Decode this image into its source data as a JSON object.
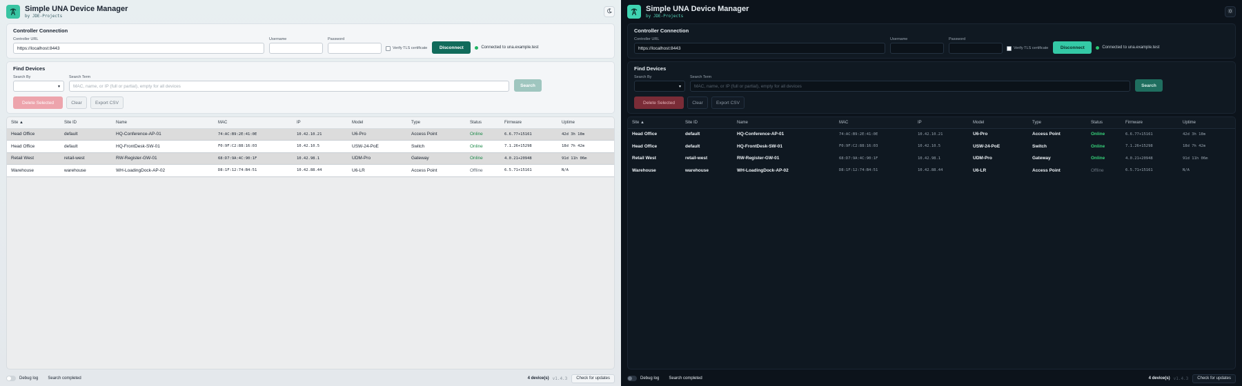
{
  "app": {
    "title": "Simple UNA Device Manager",
    "subtitle": "by JDE-Projects"
  },
  "icons": {
    "logo": "tower-icon",
    "theme_light": "moon-icon",
    "theme_dark": "sun-icon"
  },
  "connection": {
    "title": "Controller Connection",
    "url_label": "Controller URL",
    "url_value": "https://localhost:8443",
    "username_label": "Username",
    "username_value": "",
    "password_label": "Password",
    "password_value": "",
    "verify_tls_label": "Verify TLS certificate",
    "disconnect_label": "Disconnect",
    "status_text": "Connected to una.example.test"
  },
  "find": {
    "title": "Find Devices",
    "search_by_label": "Search By",
    "search_by_value": "",
    "term_label": "Search Term",
    "term_placeholder": "MAC, name, or IP (full or partial), empty for all devices",
    "search_label": "Search",
    "delete_label": "Delete Selected",
    "clear_label": "Clear",
    "export_label": "Export CSV"
  },
  "table": {
    "headers": [
      "Site ▲",
      "Site ID",
      "Name",
      "MAC",
      "IP",
      "Model",
      "Type",
      "Status",
      "Firmware",
      "Uptime"
    ],
    "rows": [
      [
        "Head Office",
        "default",
        "HQ-Conference-AP-01",
        "74:AC:B9:2E:41:0E",
        "10.42.10.21",
        "U6-Pro",
        "Access Point",
        "Online",
        "6.6.77+15161",
        "42d 3h 18m"
      ],
      [
        "Head Office",
        "default",
        "HQ-FrontDesk-SW-01",
        "F0:9F:C2:88:16:03",
        "10.42.10.5",
        "USW-24-PoE",
        "Switch",
        "Online",
        "7.1.26+15298",
        "18d 7h 42m"
      ],
      [
        "Retail West",
        "retail-west",
        "RW-Register-GW-01",
        "68:D7:9A:4C:90:1F",
        "10.42.98.1",
        "UDM-Pro",
        "Gateway",
        "Online",
        "4.0.21+20948",
        "91d 11h 06m"
      ],
      [
        "Warehouse",
        "warehouse",
        "WH-LoadingDock-AP-02",
        "D8:1F:12:74:B4:51",
        "10.42.88.44",
        "U6-LR",
        "Access Point",
        "Offline",
        "6.5.71+15161",
        "N/A"
      ]
    ]
  },
  "footer": {
    "debug_label": "Debug log",
    "status_text": "Search completed",
    "count_text": "4 device(s)",
    "version": "v1.4.3",
    "update_label": "Check for updates"
  },
  "colors": {
    "accent_light": "#116b5b",
    "accent_dark": "#34c9a6",
    "online": "#1c8a49"
  }
}
